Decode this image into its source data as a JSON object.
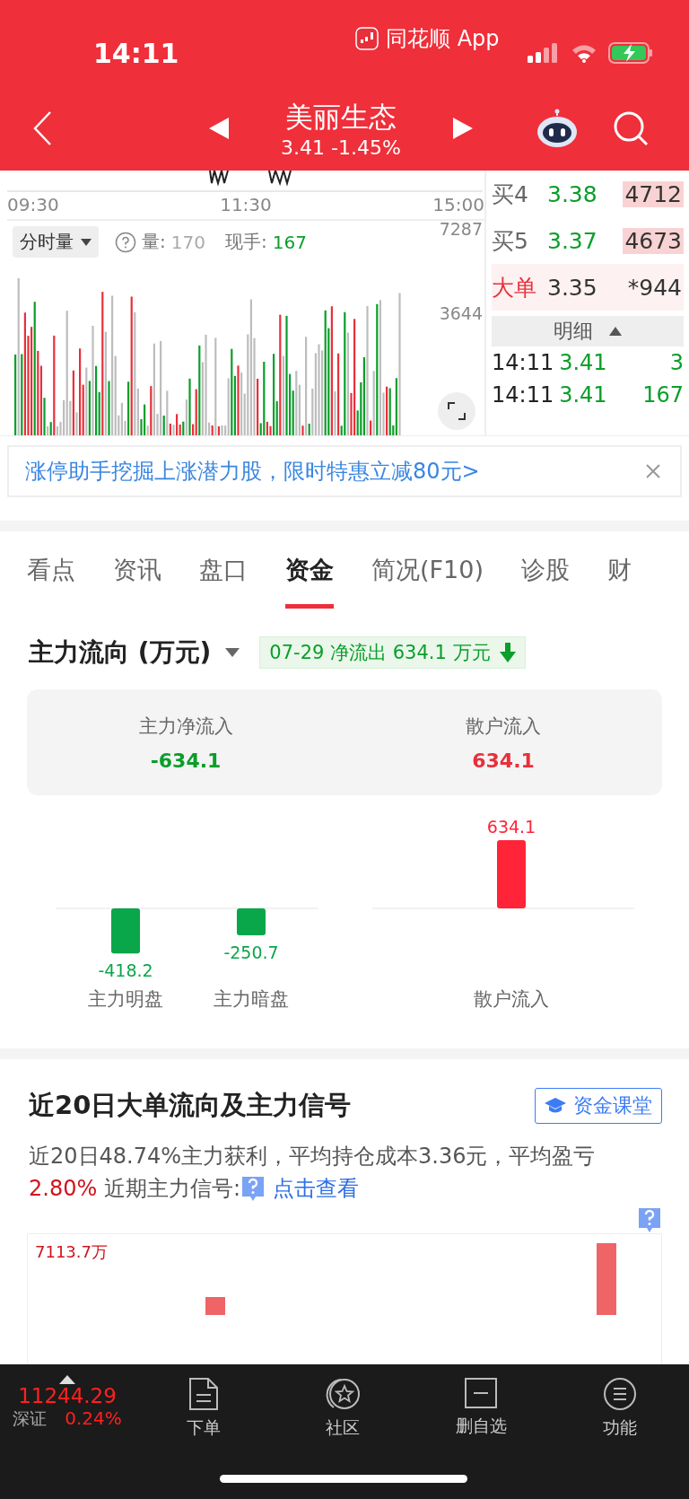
{
  "status_bar": {
    "time": "14:11",
    "app_label": "同花顺 App"
  },
  "nav": {
    "title": "美丽生态",
    "quote": "3.41 -1.45%"
  },
  "intraday": {
    "time_labels": [
      "09:30",
      "11:30",
      "15:00"
    ],
    "volume_panel": {
      "selector": "分时量",
      "volume_label": "量:",
      "volume_value": "170",
      "hand_label": "现手:",
      "hand_value": "167",
      "axis_labels": [
        "7287",
        "3644"
      ]
    }
  },
  "order_book": {
    "rows": [
      {
        "kind": "bid",
        "label": "买4",
        "price": "3.38",
        "volume": "4712",
        "highlighted": true
      },
      {
        "kind": "bid",
        "label": "买5",
        "price": "3.37",
        "volume": "4673",
        "highlighted": true
      },
      {
        "kind": "big_order",
        "label": "大单",
        "price": "3.35",
        "volume": "*944",
        "highlighted": false
      }
    ],
    "detail_header": "明细",
    "trades": [
      {
        "time": "14:11",
        "price": "3.41",
        "volume": "3"
      },
      {
        "time": "14:11",
        "price": "3.41",
        "volume": "167"
      }
    ]
  },
  "banner": {
    "text": "涨停助手挖掘上涨潜力股，限时特惠立减80元>"
  },
  "tabs": [
    {
      "label": "看点",
      "selected": false
    },
    {
      "label": "资讯",
      "selected": false
    },
    {
      "label": "盘口",
      "selected": false
    },
    {
      "label": "资金",
      "selected": true
    },
    {
      "label": "简况(F10)",
      "selected": false
    },
    {
      "label": "诊股",
      "selected": false
    },
    {
      "label": "财",
      "selected": false
    }
  ],
  "flow": {
    "title": "主力流向 (万元)",
    "badge": "07-29 净流出 634.1 万元",
    "summary": [
      {
        "label": "主力净流入",
        "value": "-634.1",
        "color": "#0a9e2a"
      },
      {
        "label": "散户流入",
        "value": "634.1",
        "color": "#e8303a"
      }
    ],
    "main_chart": {
      "chart_data": {
        "type": "bar",
        "categories": [
          "主力明盘",
          "主力暗盘"
        ],
        "values": [
          -418.2,
          -250.7
        ],
        "data_labels": true
      }
    },
    "retail_chart": {
      "chart_data": {
        "type": "bar",
        "categories": [
          "散户流入"
        ],
        "values": [
          634.1
        ],
        "data_labels": true
      }
    }
  },
  "big_orders": {
    "title": "近20日大单流向及主力信号",
    "button": "资金课堂",
    "summary_before": "近20日48.74%主力获利，平均持仓成本3.36元，平均盈亏",
    "summary_highlight": "2.80%",
    "summary_after": "近期主力信号:",
    "link": "点击查看",
    "chart_label": "7113.7万"
  },
  "bottom_nav": {
    "index": {
      "value": "11244.29",
      "name": "深证",
      "change": "0.24%"
    },
    "items": [
      {
        "label": "下单"
      },
      {
        "label": "社区"
      },
      {
        "label": "删自选"
      },
      {
        "label": "功能"
      }
    ]
  }
}
